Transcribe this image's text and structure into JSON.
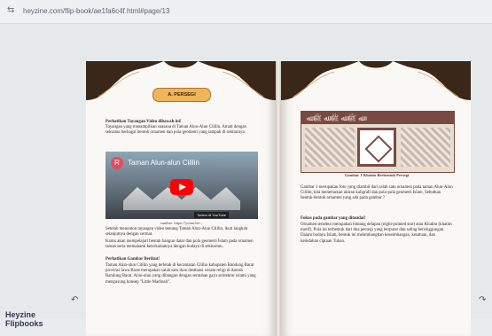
{
  "browser": {
    "url": "heyzine.com/flip-book/ae1fa6c4f.html#page/13"
  },
  "left_page": {
    "section_title": "A. PERSEGI",
    "heading1": "Perhatikan Tayangan Video dibawah ini!",
    "para1": "Tayangan yang menampilkan suasana di Taman Alun-Alun Cililin. Amati dengan seksama berbagai bentuk ornamen dan pola geometri yang tampak di sekitarnya.",
    "video": {
      "avatar_letter": "R",
      "title": "Taman Alun-alun Cililin",
      "watch_label": "Tonton di YouTube"
    },
    "video_source": "sumber: https://youtu.be/...",
    "para2": "Setelah menonton tayangan video tentang Taman Alun-Alun Cililin, ikuti langkah selanjutnya dengan cermat.",
    "para3": "Kamu akan mempelajari bentuk bangun datar dan pola geometri Islam pada ornamen taman serta memahami keterkaitannya dengan budaya di sekitarmu.",
    "heading2": "Perhatikan Gambar Berikut!",
    "para4": "Taman Alun-alun Cililin yang terletak di kecamatan Cililin kabupaten Bandung Barat provinsi Jawa Barat merupakan salah satu ikon destinasi wisata religi di daerah Bandung Barat. Alun-alun yang dibangun dengan sentuhan gaya arsitektur islami yang mengusung konsep \"Little Madinah\"."
  },
  "right_page": {
    "figure_caption": "Gambar 1 Khatim Berbentuk Persegi",
    "para1": "Gambar 1 merupakan foto yang diambil dari salah satu ornamen pada taman Alun-Alun Cililin, kita menemukan ukiran kaligrafi dan pola-pola geometri Islam. Sebutkan bentuk-bentuk ornamen yang ada pada gambar ?",
    "heading": "Fokus pada gambar yang ditandai!",
    "para2": "Ornamen tersebut merupakan bintang delapan (eight-pointed star) atau Khatim (khatim motif). Pola ini terbentuk dari dua persegi yang berputar dan saling bersinggungan. Dalam budaya Islam, bentuk ini melambangkan keseimbangan, kesatuan, dan keindahan ciptaan Tuhan."
  },
  "branding": {
    "line1": "Heyzine",
    "line2": "Flipbooks"
  },
  "icons": {
    "url": "tune-icon",
    "prev": "arrow-left-icon",
    "next": "arrow-right-icon"
  },
  "colors": {
    "badge": "#f0b45a",
    "ornament": "#3a2718",
    "accent": "#7a4a42"
  }
}
